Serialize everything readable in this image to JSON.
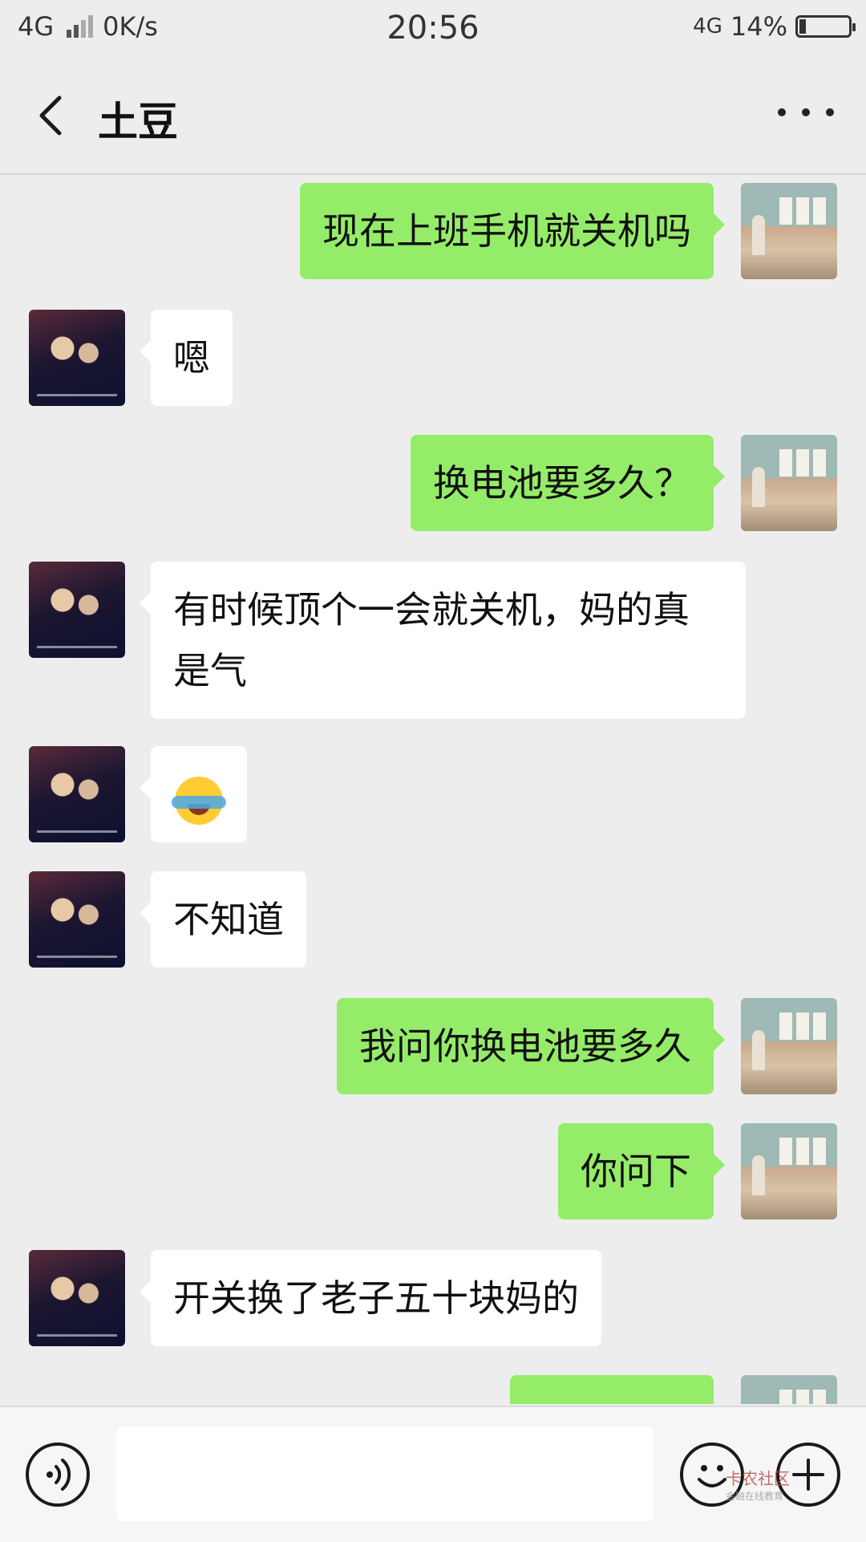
{
  "status_bar": {
    "network": "4G",
    "speed": "0K/s",
    "time": "20:56",
    "network_right": "4G",
    "battery": "14%",
    "battery_level": 0.14
  },
  "nav": {
    "title": "土豆",
    "back_icon": "chevron-left-icon",
    "more_icon": "more-dots-icon"
  },
  "messages": [
    {
      "side": "self",
      "text": "现在上班手机就关机吗"
    },
    {
      "side": "other",
      "text": "嗯"
    },
    {
      "side": "self",
      "text": "换电池要多久？"
    },
    {
      "side": "other",
      "text": "有时候顶个一会就关机，妈的真是气"
    },
    {
      "side": "other",
      "emoji": "face-with-tears-of-joy-icon"
    },
    {
      "side": "other",
      "text": "不知道"
    },
    {
      "side": "self",
      "text": "我问你换电池要多久"
    },
    {
      "side": "self",
      "text": "你问下"
    },
    {
      "side": "other",
      "text": "开关换了老子五十块妈的"
    }
  ],
  "input_bar": {
    "voice_icon": "voice-icon",
    "emoji_icon": "emoji-icon",
    "plus_icon": "plus-icon",
    "watermark_title": "卡农社区",
    "watermark_sub": "金融在线教育"
  },
  "colors": {
    "background": "#ededed",
    "self_bubble": "#95ec69",
    "other_bubble": "#ffffff"
  }
}
